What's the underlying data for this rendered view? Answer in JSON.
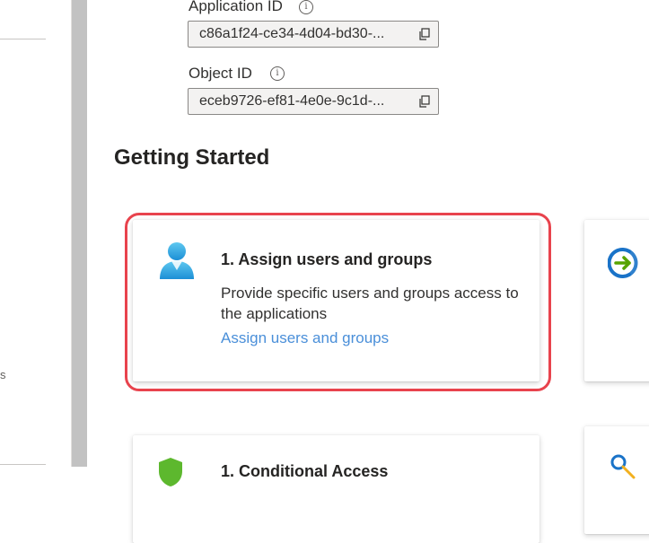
{
  "properties": {
    "application_id": {
      "label": "Application ID",
      "value": "c86a1f24-ce34-4d04-bd30-...",
      "info_glyph": "i"
    },
    "object_id": {
      "label": "Object ID",
      "value": "eceb9726-ef81-4e0e-9c1d-...",
      "info_glyph": "i"
    }
  },
  "getting_started": {
    "title": "Getting Started",
    "cards": [
      {
        "title": "1. Assign users and groups",
        "description": "Provide specific users and groups access to the applications",
        "link": "Assign users and groups",
        "icon": "user-icon",
        "highlighted": true
      },
      {
        "icon": "arrow-signin-icon"
      },
      {
        "title": "1. Conditional Access",
        "icon": "shield-icon"
      },
      {
        "icon": "key-icon"
      }
    ]
  },
  "left_nav": {
    "partial_letter": "s"
  },
  "colors": {
    "highlight_border": "#e8434d",
    "link": "#4a8fd9",
    "field_bg": "#f3f2f1",
    "scrollbar": "#c2c2c2"
  }
}
